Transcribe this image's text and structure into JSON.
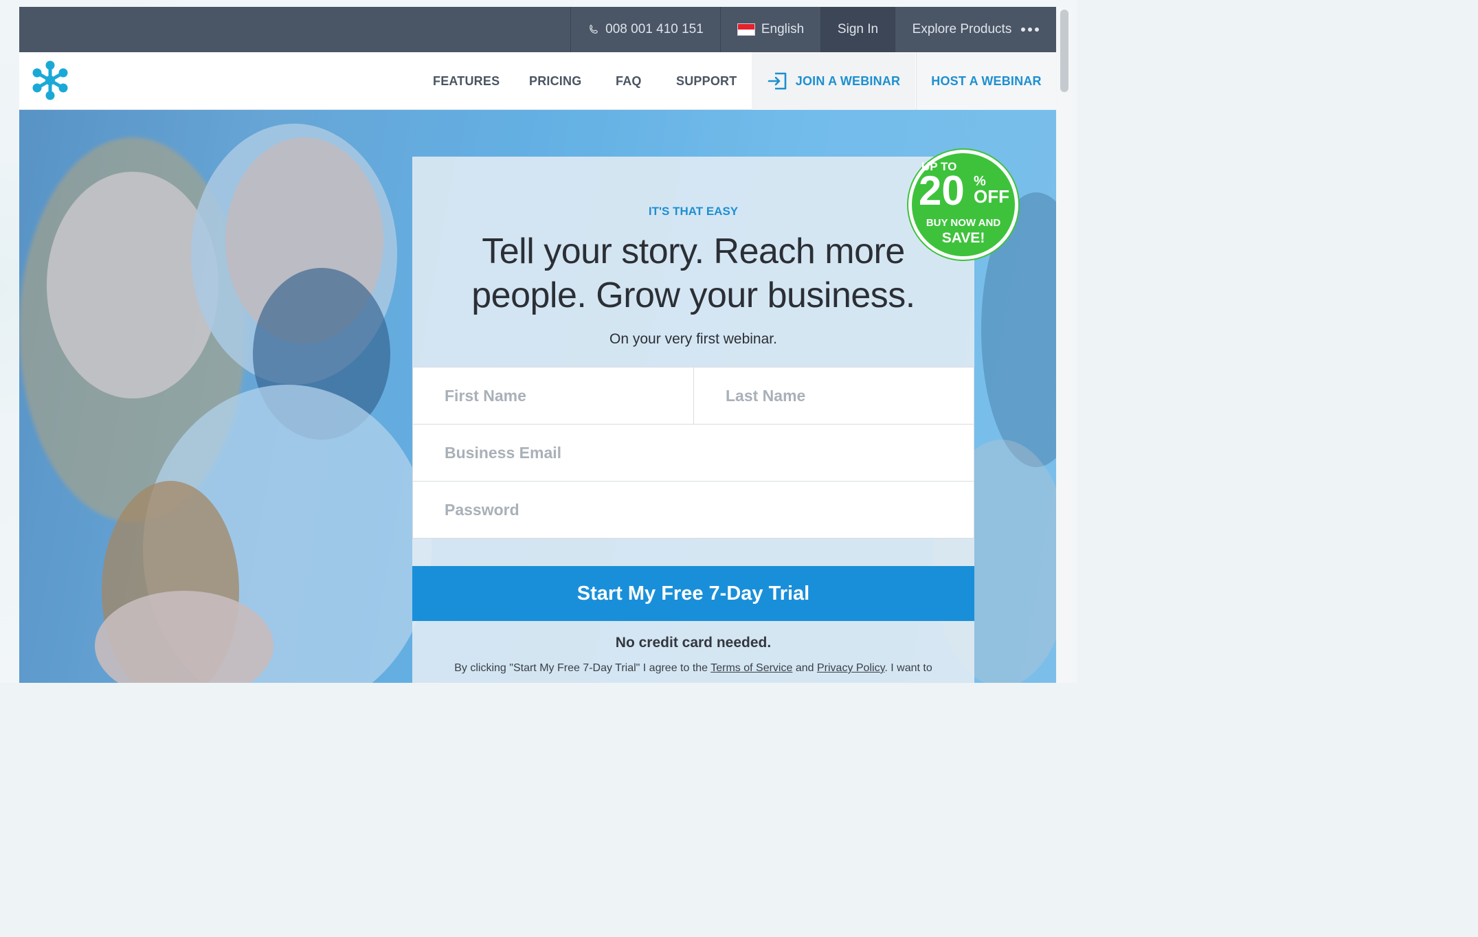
{
  "topbar": {
    "phone": "008 001 410 151",
    "language": "English",
    "sign_in": "Sign In",
    "explore": "Explore Products"
  },
  "nav": {
    "features": "FEATURES",
    "pricing": "PRICING",
    "faq": "FAQ",
    "support": "SUPPORT",
    "join": "JOIN A WEBINAR",
    "host": "HOST A WEBINAR"
  },
  "hero": {
    "kicker": "IT'S THAT EASY",
    "headline_line1": "Tell your story. Reach more",
    "headline_line2": "people. Grow your business.",
    "subline": "On your very first webinar."
  },
  "form": {
    "first_name_placeholder": "First Name",
    "last_name_placeholder": "Last Name",
    "email_placeholder": "Business Email",
    "password_placeholder": "Password",
    "submit": "Start My Free 7-Day Trial",
    "no_card": "No credit card needed.",
    "legal_prefix": "By clicking \"Start My Free 7-Day Trial\" I agree to the",
    "terms": "Terms of Service",
    "and": "and",
    "privacy": "Privacy Policy",
    "legal_suffix": ". I want to"
  },
  "badge": {
    "up_to": "UP TO",
    "amount": "20",
    "percent": "%",
    "off": "OFF",
    "buy_now": "BUY NOW AND",
    "save": "SAVE!"
  },
  "colors": {
    "brand_blue": "#1a8fd9",
    "topbar": "#4a5566",
    "badge_green": "#3ec23c",
    "logo": "#1aa9d6"
  },
  "icons": {
    "phone": "phone-icon",
    "flag": "flag-icon",
    "more": "more-dots-icon",
    "logo": "snowflake-logo-icon",
    "join": "enter-arrow-icon"
  }
}
